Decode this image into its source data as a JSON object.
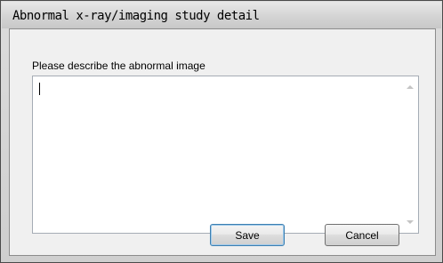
{
  "window": {
    "title": "Abnormal x-ray/imaging study detail"
  },
  "form": {
    "description_label": "Please describe the abnormal image",
    "description_value": ""
  },
  "buttons": {
    "save": "Save",
    "cancel": "Cancel"
  }
}
